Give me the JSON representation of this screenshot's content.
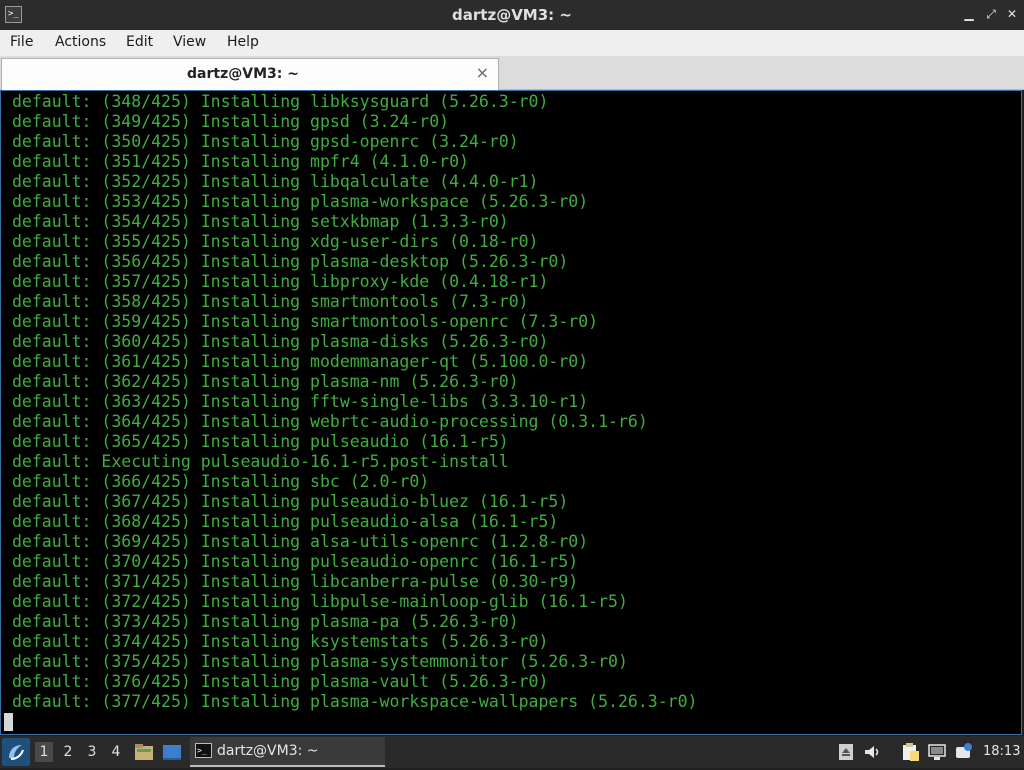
{
  "window": {
    "title": "dartz@VM3: ~",
    "icon": "terminal-icon",
    "icon_glyph": ">_",
    "controls": {
      "minimize": "▁",
      "restore": "⤢",
      "close": "✕"
    }
  },
  "menu": {
    "items": [
      "File",
      "Actions",
      "Edit",
      "View",
      "Help"
    ]
  },
  "tabs": [
    {
      "label": "dartz@VM3: ~",
      "close": "×"
    }
  ],
  "terminal": {
    "text_color": "#3fae3f",
    "lines": [
      "default: (348/425) Installing libksysguard (5.26.3-r0)",
      "default: (349/425) Installing gpsd (3.24-r0)",
      "default: (350/425) Installing gpsd-openrc (3.24-r0)",
      "default: (351/425) Installing mpfr4 (4.1.0-r0)",
      "default: (352/425) Installing libqalculate (4.4.0-r1)",
      "default: (353/425) Installing plasma-workspace (5.26.3-r0)",
      "default: (354/425) Installing setxkbmap (1.3.3-r0)",
      "default: (355/425) Installing xdg-user-dirs (0.18-r0)",
      "default: (356/425) Installing plasma-desktop (5.26.3-r0)",
      "default: (357/425) Installing libproxy-kde (0.4.18-r1)",
      "default: (358/425) Installing smartmontools (7.3-r0)",
      "default: (359/425) Installing smartmontools-openrc (7.3-r0)",
      "default: (360/425) Installing plasma-disks (5.26.3-r0)",
      "default: (361/425) Installing modemmanager-qt (5.100.0-r0)",
      "default: (362/425) Installing plasma-nm (5.26.3-r0)",
      "default: (363/425) Installing fftw-single-libs (3.3.10-r1)",
      "default: (364/425) Installing webrtc-audio-processing (0.3.1-r6)",
      "default: (365/425) Installing pulseaudio (16.1-r5)",
      "default: Executing pulseaudio-16.1-r5.post-install",
      "default: (366/425) Installing sbc (2.0-r0)",
      "default: (367/425) Installing pulseaudio-bluez (16.1-r5)",
      "default: (368/425) Installing pulseaudio-alsa (16.1-r5)",
      "default: (369/425) Installing alsa-utils-openrc (1.2.8-r0)",
      "default: (370/425) Installing pulseaudio-openrc (16.1-r5)",
      "default: (371/425) Installing libcanberra-pulse (0.30-r9)",
      "default: (372/425) Installing libpulse-mainloop-glib (16.1-r5)",
      "default: (373/425) Installing plasma-pa (5.26.3-r0)",
      "default: (374/425) Installing ksystemstats (5.26.3-r0)",
      "default: (375/425) Installing plasma-systemmonitor (5.26.3-r0)",
      "default: (376/425) Installing plasma-vault (5.26.3-r0)",
      "default: (377/425) Installing plasma-workspace-wallpapers (5.26.3-r0)"
    ]
  },
  "taskbar": {
    "start_icon": "lxqt-start-icon",
    "workspaces": [
      "1",
      "2",
      "3",
      "4"
    ],
    "active_workspace": "1",
    "quicklaunch": [
      "file-manager-icon",
      "show-desktop-icon"
    ],
    "task": {
      "icon": "terminal-icon",
      "icon_glyph": ">_",
      "label": "dartz@VM3: ~"
    },
    "tray": [
      "eject-icon",
      "volume-icon",
      "clipboard-icon",
      "network-icon",
      "notification-icon"
    ],
    "clock": "18:13"
  }
}
